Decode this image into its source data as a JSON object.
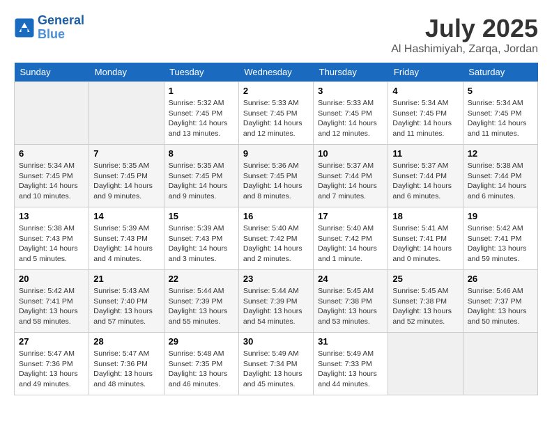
{
  "header": {
    "logo_line1": "General",
    "logo_line2": "Blue",
    "month_year": "July 2025",
    "location": "Al Hashimiyah, Zarqa, Jordan"
  },
  "days_of_week": [
    "Sunday",
    "Monday",
    "Tuesday",
    "Wednesday",
    "Thursday",
    "Friday",
    "Saturday"
  ],
  "weeks": [
    [
      {
        "day": "",
        "empty": true
      },
      {
        "day": "",
        "empty": true
      },
      {
        "day": "1",
        "sunrise": "Sunrise: 5:32 AM",
        "sunset": "Sunset: 7:45 PM",
        "daylight": "Daylight: 14 hours and 13 minutes."
      },
      {
        "day": "2",
        "sunrise": "Sunrise: 5:33 AM",
        "sunset": "Sunset: 7:45 PM",
        "daylight": "Daylight: 14 hours and 12 minutes."
      },
      {
        "day": "3",
        "sunrise": "Sunrise: 5:33 AM",
        "sunset": "Sunset: 7:45 PM",
        "daylight": "Daylight: 14 hours and 12 minutes."
      },
      {
        "day": "4",
        "sunrise": "Sunrise: 5:34 AM",
        "sunset": "Sunset: 7:45 PM",
        "daylight": "Daylight: 14 hours and 11 minutes."
      },
      {
        "day": "5",
        "sunrise": "Sunrise: 5:34 AM",
        "sunset": "Sunset: 7:45 PM",
        "daylight": "Daylight: 14 hours and 11 minutes."
      }
    ],
    [
      {
        "day": "6",
        "sunrise": "Sunrise: 5:34 AM",
        "sunset": "Sunset: 7:45 PM",
        "daylight": "Daylight: 14 hours and 10 minutes."
      },
      {
        "day": "7",
        "sunrise": "Sunrise: 5:35 AM",
        "sunset": "Sunset: 7:45 PM",
        "daylight": "Daylight: 14 hours and 9 minutes."
      },
      {
        "day": "8",
        "sunrise": "Sunrise: 5:35 AM",
        "sunset": "Sunset: 7:45 PM",
        "daylight": "Daylight: 14 hours and 9 minutes."
      },
      {
        "day": "9",
        "sunrise": "Sunrise: 5:36 AM",
        "sunset": "Sunset: 7:45 PM",
        "daylight": "Daylight: 14 hours and 8 minutes."
      },
      {
        "day": "10",
        "sunrise": "Sunrise: 5:37 AM",
        "sunset": "Sunset: 7:44 PM",
        "daylight": "Daylight: 14 hours and 7 minutes."
      },
      {
        "day": "11",
        "sunrise": "Sunrise: 5:37 AM",
        "sunset": "Sunset: 7:44 PM",
        "daylight": "Daylight: 14 hours and 6 minutes."
      },
      {
        "day": "12",
        "sunrise": "Sunrise: 5:38 AM",
        "sunset": "Sunset: 7:44 PM",
        "daylight": "Daylight: 14 hours and 6 minutes."
      }
    ],
    [
      {
        "day": "13",
        "sunrise": "Sunrise: 5:38 AM",
        "sunset": "Sunset: 7:43 PM",
        "daylight": "Daylight: 14 hours and 5 minutes."
      },
      {
        "day": "14",
        "sunrise": "Sunrise: 5:39 AM",
        "sunset": "Sunset: 7:43 PM",
        "daylight": "Daylight: 14 hours and 4 minutes."
      },
      {
        "day": "15",
        "sunrise": "Sunrise: 5:39 AM",
        "sunset": "Sunset: 7:43 PM",
        "daylight": "Daylight: 14 hours and 3 minutes."
      },
      {
        "day": "16",
        "sunrise": "Sunrise: 5:40 AM",
        "sunset": "Sunset: 7:42 PM",
        "daylight": "Daylight: 14 hours and 2 minutes."
      },
      {
        "day": "17",
        "sunrise": "Sunrise: 5:40 AM",
        "sunset": "Sunset: 7:42 PM",
        "daylight": "Daylight: 14 hours and 1 minute."
      },
      {
        "day": "18",
        "sunrise": "Sunrise: 5:41 AM",
        "sunset": "Sunset: 7:41 PM",
        "daylight": "Daylight: 14 hours and 0 minutes."
      },
      {
        "day": "19",
        "sunrise": "Sunrise: 5:42 AM",
        "sunset": "Sunset: 7:41 PM",
        "daylight": "Daylight: 13 hours and 59 minutes."
      }
    ],
    [
      {
        "day": "20",
        "sunrise": "Sunrise: 5:42 AM",
        "sunset": "Sunset: 7:41 PM",
        "daylight": "Daylight: 13 hours and 58 minutes."
      },
      {
        "day": "21",
        "sunrise": "Sunrise: 5:43 AM",
        "sunset": "Sunset: 7:40 PM",
        "daylight": "Daylight: 13 hours and 57 minutes."
      },
      {
        "day": "22",
        "sunrise": "Sunrise: 5:44 AM",
        "sunset": "Sunset: 7:39 PM",
        "daylight": "Daylight: 13 hours and 55 minutes."
      },
      {
        "day": "23",
        "sunrise": "Sunrise: 5:44 AM",
        "sunset": "Sunset: 7:39 PM",
        "daylight": "Daylight: 13 hours and 54 minutes."
      },
      {
        "day": "24",
        "sunrise": "Sunrise: 5:45 AM",
        "sunset": "Sunset: 7:38 PM",
        "daylight": "Daylight: 13 hours and 53 minutes."
      },
      {
        "day": "25",
        "sunrise": "Sunrise: 5:45 AM",
        "sunset": "Sunset: 7:38 PM",
        "daylight": "Daylight: 13 hours and 52 minutes."
      },
      {
        "day": "26",
        "sunrise": "Sunrise: 5:46 AM",
        "sunset": "Sunset: 7:37 PM",
        "daylight": "Daylight: 13 hours and 50 minutes."
      }
    ],
    [
      {
        "day": "27",
        "sunrise": "Sunrise: 5:47 AM",
        "sunset": "Sunset: 7:36 PM",
        "daylight": "Daylight: 13 hours and 49 minutes."
      },
      {
        "day": "28",
        "sunrise": "Sunrise: 5:47 AM",
        "sunset": "Sunset: 7:36 PM",
        "daylight": "Daylight: 13 hours and 48 minutes."
      },
      {
        "day": "29",
        "sunrise": "Sunrise: 5:48 AM",
        "sunset": "Sunset: 7:35 PM",
        "daylight": "Daylight: 13 hours and 46 minutes."
      },
      {
        "day": "30",
        "sunrise": "Sunrise: 5:49 AM",
        "sunset": "Sunset: 7:34 PM",
        "daylight": "Daylight: 13 hours and 45 minutes."
      },
      {
        "day": "31",
        "sunrise": "Sunrise: 5:49 AM",
        "sunset": "Sunset: 7:33 PM",
        "daylight": "Daylight: 13 hours and 44 minutes."
      },
      {
        "day": "",
        "empty": true
      },
      {
        "day": "",
        "empty": true
      }
    ]
  ]
}
